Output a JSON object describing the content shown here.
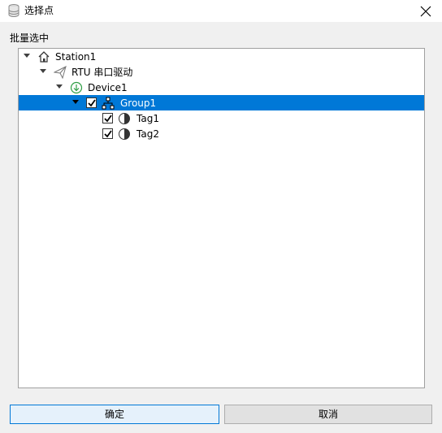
{
  "window": {
    "title": "选择点",
    "title_icon": "database-icon",
    "close_icon": "close-icon"
  },
  "section_label": "批量选中",
  "tree": {
    "station": {
      "label": "Station1",
      "icon": "home-icon",
      "expanded": true
    },
    "driver": {
      "label": "RTU 串口驱动",
      "icon": "paper-plane-icon",
      "expanded": true
    },
    "device": {
      "label": "Device1",
      "icon": "download-circle-icon",
      "expanded": true
    },
    "group": {
      "label": "Group1",
      "icon": "network-icon",
      "checked": true,
      "selected": true,
      "expanded": true
    },
    "tags": [
      {
        "label": "Tag1",
        "icon": "half-circle-icon",
        "checked": true
      },
      {
        "label": "Tag2",
        "icon": "half-circle-icon",
        "checked": true
      }
    ]
  },
  "buttons": {
    "ok": "确定",
    "cancel": "取消"
  },
  "colors": {
    "selection": "#0078d7",
    "device_icon": "#2e9e44",
    "background": "#f0f0f0"
  }
}
